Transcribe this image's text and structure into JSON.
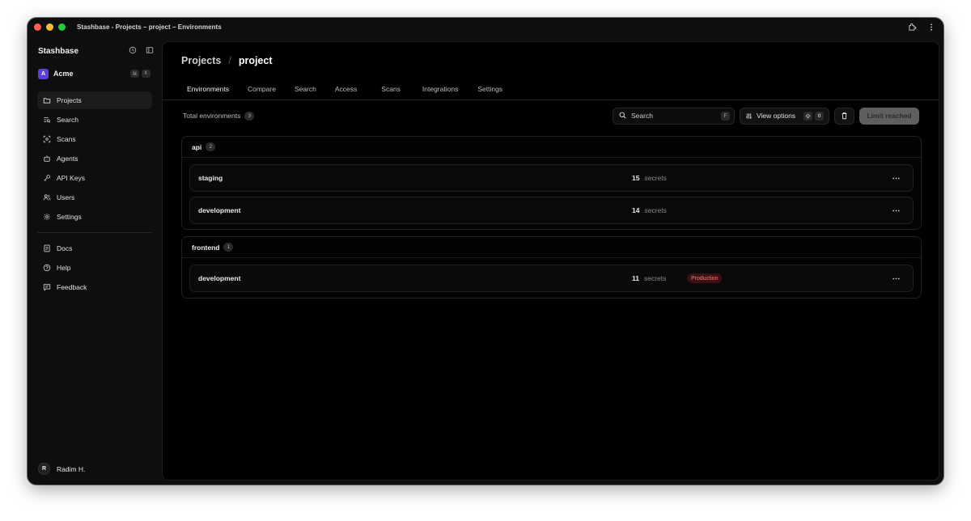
{
  "window": {
    "title": "Stashbase - Projects – project – Environments",
    "traffic_lights": [
      "#ff5f57",
      "#febc2e",
      "#28c840"
    ]
  },
  "sidebar": {
    "brand": "Stashbase",
    "org": {
      "avatar": "A",
      "name": "Acme",
      "shortcut": [
        "⌘",
        "K"
      ],
      "avatar_color": "#5b3fd6"
    },
    "nav_primary": [
      {
        "label": "Projects",
        "icon": "folder-icon",
        "active": true
      },
      {
        "label": "Search",
        "icon": "search-list-icon"
      },
      {
        "label": "Scans",
        "icon": "scan-icon"
      },
      {
        "label": "Agents",
        "icon": "bot-icon"
      },
      {
        "label": "API Keys",
        "icon": "key-icon"
      },
      {
        "label": "Users",
        "icon": "users-icon"
      },
      {
        "label": "Settings",
        "icon": "gear-icon"
      }
    ],
    "nav_secondary": [
      {
        "label": "Docs",
        "icon": "document-icon"
      },
      {
        "label": "Help",
        "icon": "help-circle-icon"
      },
      {
        "label": "Feedback",
        "icon": "message-icon"
      }
    ],
    "user": {
      "initial": "R",
      "name": "Radim H."
    }
  },
  "header": {
    "breadcrumb": {
      "parent": "Projects",
      "separator": "/",
      "current": "project"
    },
    "tabs": [
      "Environments",
      "Compare",
      "Search",
      "Access",
      "Scans",
      "Integrations",
      "Settings"
    ],
    "active_tab": "Environments"
  },
  "toolbar": {
    "total_label": "Total environments",
    "total_count": "3",
    "search_placeholder": "Search",
    "search_shortcut": "F",
    "view_options_label": "View options",
    "view_options_count": "0",
    "limit_label": "Limit reached"
  },
  "groups": [
    {
      "name": "api",
      "count": "2",
      "environments": [
        {
          "name": "staging",
          "secrets": "15",
          "secrets_label": "secrets"
        },
        {
          "name": "development",
          "secrets": "14",
          "secrets_label": "secrets"
        }
      ]
    },
    {
      "name": "frontend",
      "count": "1",
      "environments": [
        {
          "name": "development",
          "secrets": "11",
          "secrets_label": "secrets",
          "badge": "Production"
        }
      ]
    }
  ],
  "colors": {
    "accent": "#5b3fd6",
    "production_badge_bg": "#3a1010",
    "production_badge_text": "#ff7a7a"
  }
}
